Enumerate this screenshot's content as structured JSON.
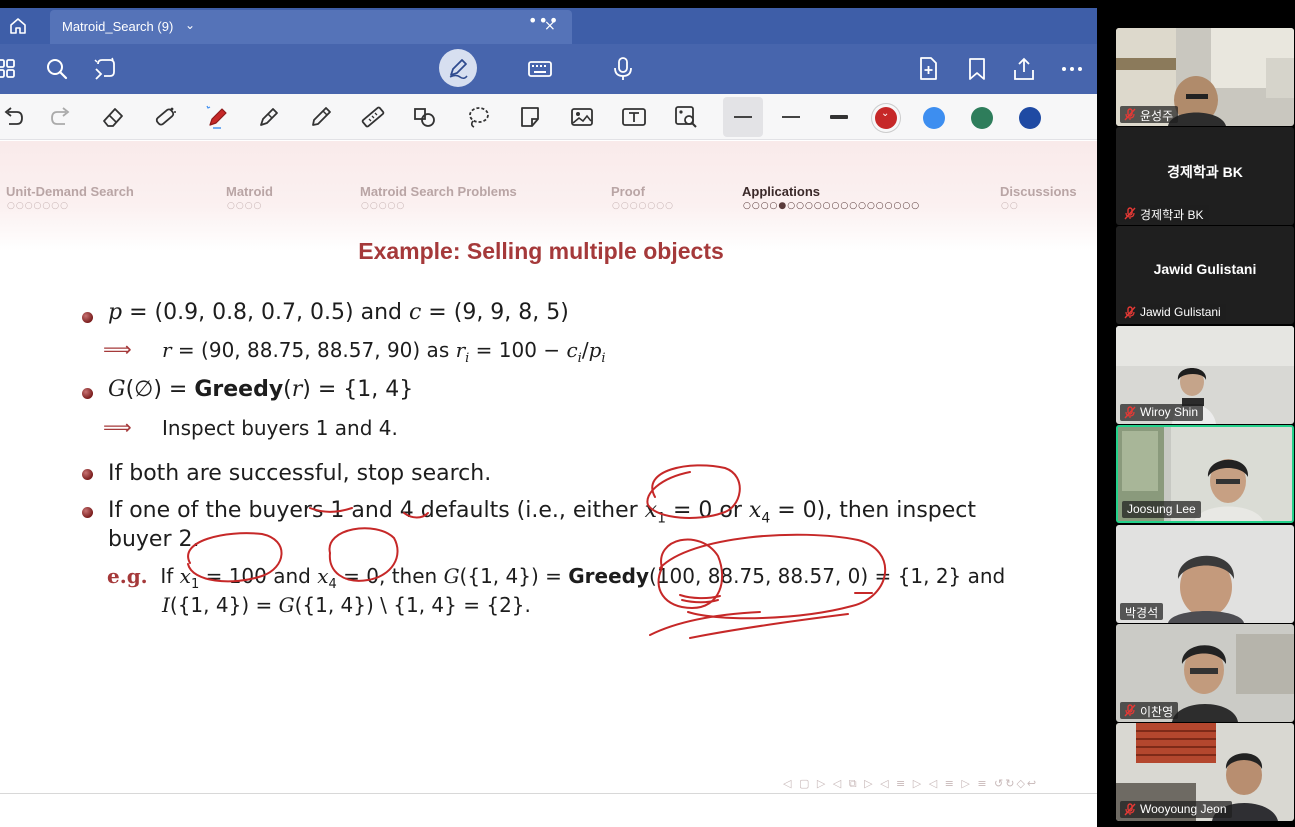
{
  "app": {
    "tab_title": "Matroid_Search (9)",
    "tab_chevron": "⌄",
    "tab_dots": "•••",
    "tab_close": "×",
    "toolbar_primary": [
      "home-icon",
      "grid-icon",
      "search-icon",
      "lasso-capture-icon",
      "pen-mode-icon",
      "keyboard-icon",
      "microphone-icon",
      "add-page-icon",
      "bookmark-icon",
      "share-icon",
      "more-icon"
    ],
    "toolbar_tools": [
      "undo-icon",
      "redo-icon",
      "eraser-icon",
      "tape-icon",
      "pen-icon",
      "highlighter-icon",
      "pencil-icon",
      "ruler-icon",
      "shapes-icon",
      "lasso-icon",
      "sticker-icon",
      "image-icon",
      "textbox-icon",
      "image-search-icon"
    ],
    "colors": {
      "tabbar": "#3e5ea8",
      "toolbar": "#4765ad",
      "swatch_red": "#c62828",
      "swatch_lightblue": "#3d8ef0",
      "swatch_green": "#2e7d5b",
      "swatch_navy": "#1f4aa3",
      "ink": "#c62828"
    }
  },
  "slide": {
    "nav_sections": [
      {
        "label": "Unit-Demand Search",
        "dots": "○○○○○○○",
        "active": false
      },
      {
        "label": "Matroid",
        "dots": "○○○○",
        "active": false
      },
      {
        "label": "Matroid Search Problems",
        "dots": "○○○○○",
        "active": false
      },
      {
        "label": "Proof",
        "dots": "○○○○○○○",
        "active": false
      },
      {
        "label": "Applications",
        "dots": "○○○○●○○○○○○○○○○○○○○○",
        "active": true
      },
      {
        "label": "Discussions",
        "dots": "○○",
        "active": false
      }
    ],
    "title": "Example: Selling multiple objects",
    "b1": {
      "p": "p",
      "eq1": " = (0.9, 0.8, 0.7, 0.5)",
      "and": " and ",
      "c": "c",
      "eq2": " = (9, 9, 8, 5)"
    },
    "b1_sub": {
      "arrow": "⟹",
      "r": "r",
      "vals": " = (90, 88.75, 88.57, 90)",
      "as": " as ",
      "ri": "r",
      "i": "i",
      "formula": " = 100 − ",
      "ci": "c",
      "ci_sub": "i",
      "slash": "/",
      "pi": "p",
      "pi_sub": "i"
    },
    "b2": {
      "G": "G",
      "arg": "(∅) = ",
      "greedy": "Greedy",
      "rarg_open": "(",
      "r": "r",
      "rarg_close": ") = {1, 4}"
    },
    "b2_sub": {
      "arrow": "⟹",
      "text": "Inspect buyers 1 and 4."
    },
    "b3": "If both are successful, stop search.",
    "b4_line1a": "If one of the buyers 1 and 4 defaults (i.e., either ",
    "b4_x1": "x",
    "b4_x1_sub": "1",
    "b4_mid": " = 0 or ",
    "b4_x4": "x",
    "b4_x4_sub": "4",
    "b4_end": " = 0), then inspect",
    "b4_line2": "buyer 2.",
    "eg": {
      "label": "e.g.",
      "if": "If ",
      "x1": "x",
      "x1s": "1",
      "v1": " = 100 and ",
      "x4": "x",
      "x4s": "4",
      "v2": " = 0, then ",
      "G": "G",
      "g_arg": "({1, 4}) = ",
      "greedy": "Greedy",
      "g_vals": "(100, 88.75, 88.57, 0) = {1, 2} and",
      "I": "I",
      "line2": "({1, 4}) = ",
      "G2": "G",
      "line2b": "({1, 4}) \\ {1, 4} = {2}."
    },
    "footer_nav": "◁ ▢ ▷ ◁ ⧉ ▷ ◁ ≡ ▷ ◁ ≡ ▷ ≡ ↺↻◇↩"
  },
  "participants": [
    {
      "name": "윤성주",
      "video": true,
      "highlight": false,
      "display": ""
    },
    {
      "name": "경제학과 BK",
      "video": false,
      "highlight": false,
      "display": "경제학과 BK"
    },
    {
      "name": "Jawid Gulistani",
      "video": false,
      "highlight": false,
      "display": "Jawid Gulistani"
    },
    {
      "name": "Wiroy Shin",
      "video": true,
      "highlight": false,
      "display": ""
    },
    {
      "name": "Joosung Lee",
      "video": true,
      "highlight": true,
      "display": ""
    },
    {
      "name": "박경석",
      "video": true,
      "highlight": false,
      "display": ""
    },
    {
      "name": "이찬영",
      "video": true,
      "highlight": false,
      "display": ""
    },
    {
      "name": "Wooyoung Jeon",
      "video": true,
      "highlight": false,
      "display": ""
    }
  ]
}
